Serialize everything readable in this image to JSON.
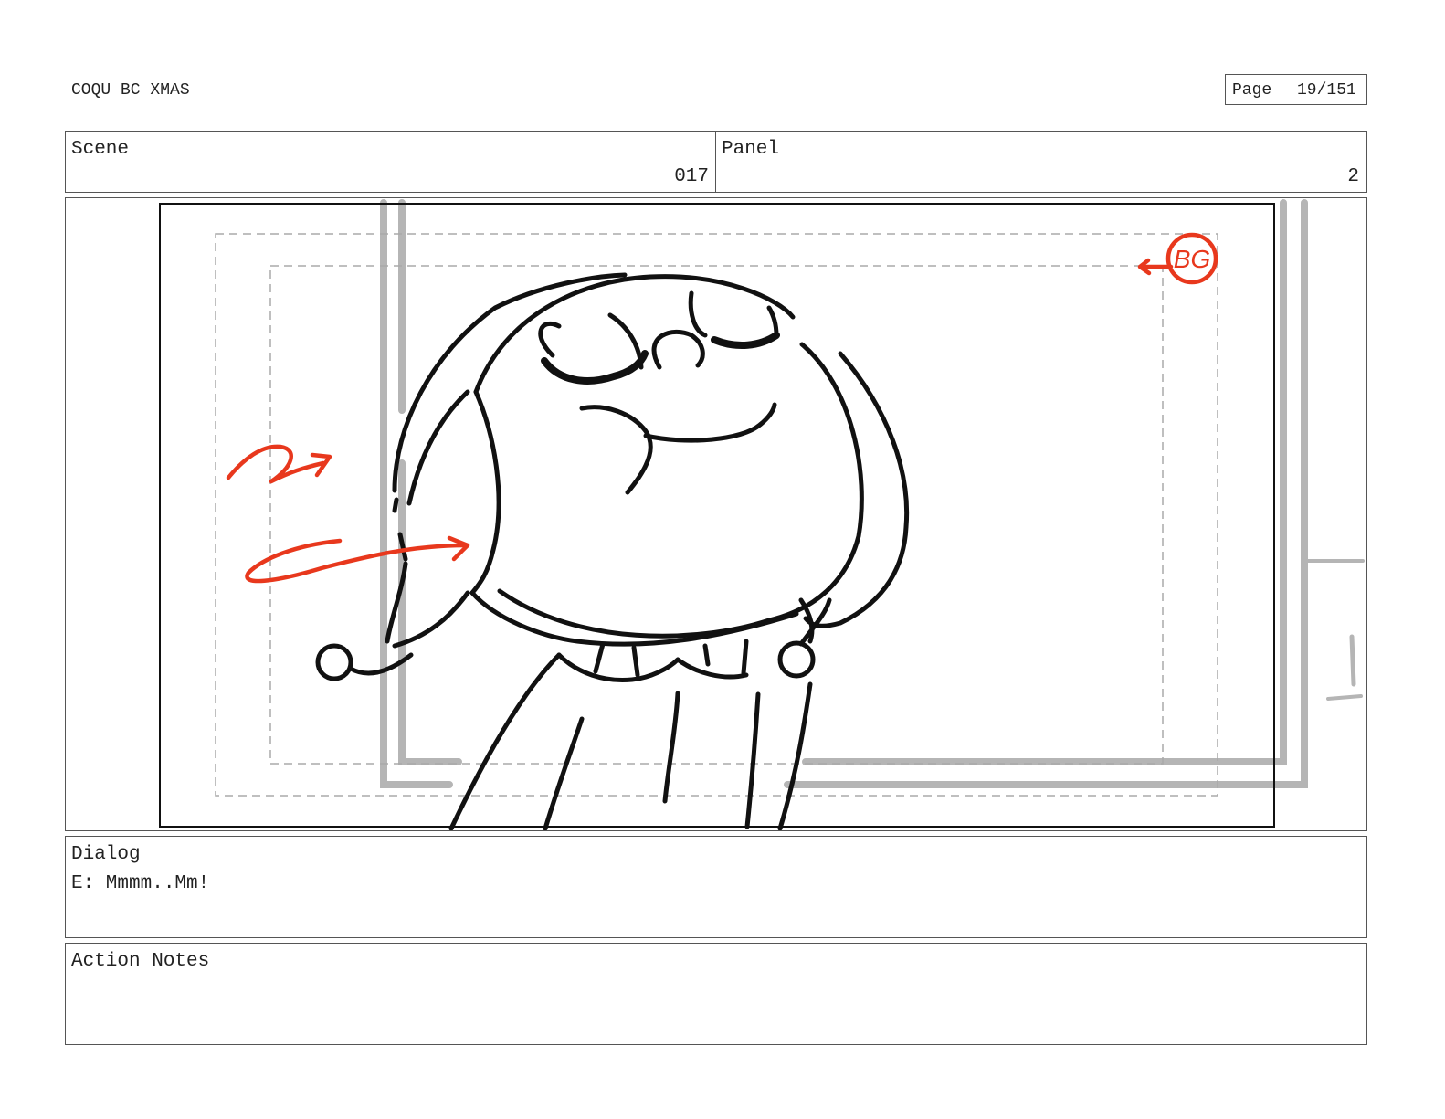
{
  "header": {
    "project_title": "COQU BC XMAS",
    "page_label": "Page",
    "page_value": "19/151"
  },
  "scene": {
    "label": "Scene",
    "value": "017"
  },
  "panel": {
    "label": "Panel",
    "value": "2"
  },
  "frame": {
    "annotation_text": "BG",
    "annotation_color": "#e8381d",
    "ink_color": "#111111",
    "bg_line_color": "#b5b5b5",
    "safe_area_color": "#aaaaaa"
  },
  "dialog": {
    "label": "Dialog",
    "text": "E: Mmmm..Mm!"
  },
  "action_notes": {
    "label": "Action Notes",
    "text": ""
  }
}
